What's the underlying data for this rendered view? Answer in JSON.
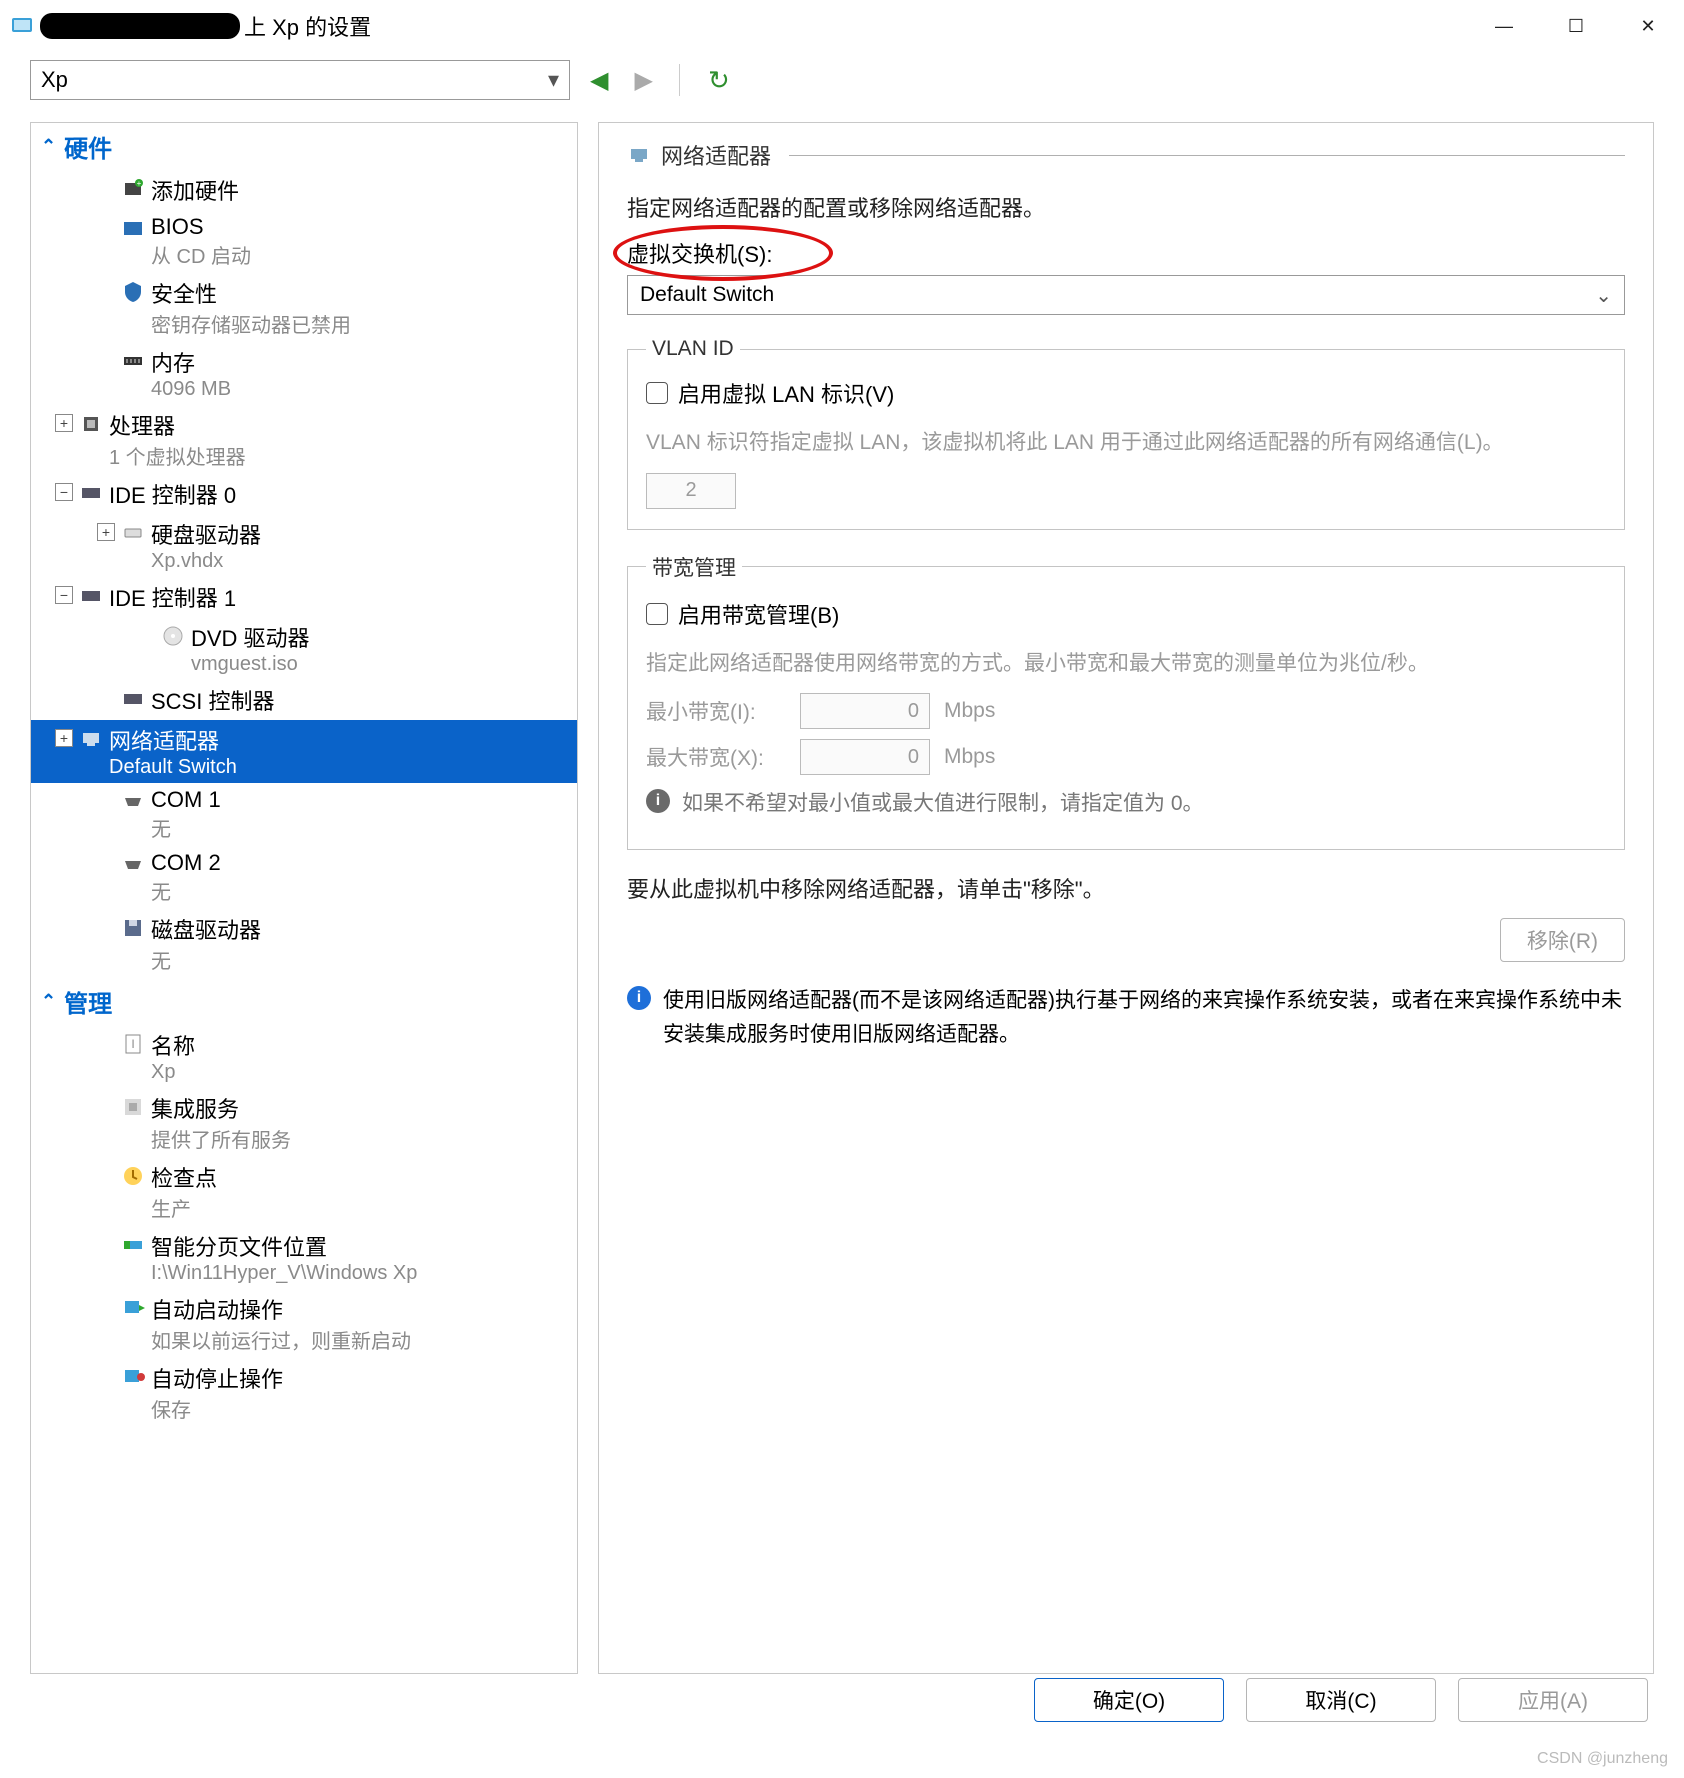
{
  "window": {
    "title_suffix": "上 Xp 的设置",
    "watermark": "CSDN @junzheng"
  },
  "toolbar": {
    "vm_selected": "Xp"
  },
  "tree": {
    "hardware_header": "硬件",
    "management_header": "管理",
    "items": {
      "add_hw": {
        "label": "添加硬件"
      },
      "bios": {
        "label": "BIOS",
        "sub": "从 CD 启动"
      },
      "security": {
        "label": "安全性",
        "sub": "密钥存储驱动器已禁用"
      },
      "memory": {
        "label": "内存",
        "sub": "4096 MB"
      },
      "cpu": {
        "label": "处理器",
        "sub": "1 个虚拟处理器"
      },
      "ide0": {
        "label": "IDE 控制器 0"
      },
      "hdd": {
        "label": "硬盘驱动器",
        "sub": "Xp.vhdx"
      },
      "ide1": {
        "label": "IDE 控制器 1"
      },
      "dvd": {
        "label": "DVD 驱动器",
        "sub": "vmguest.iso"
      },
      "scsi": {
        "label": "SCSI 控制器"
      },
      "nic": {
        "label": "网络适配器",
        "sub": "Default Switch"
      },
      "com1": {
        "label": "COM 1",
        "sub": "无"
      },
      "com2": {
        "label": "COM 2",
        "sub": "无"
      },
      "floppy": {
        "label": "磁盘驱动器",
        "sub": "无"
      },
      "name": {
        "label": "名称",
        "sub": "Xp"
      },
      "integ": {
        "label": "集成服务",
        "sub": "提供了所有服务"
      },
      "ckpt": {
        "label": "检查点",
        "sub": "生产"
      },
      "smart": {
        "label": "智能分页文件位置",
        "sub": "I:\\Win11Hyper_V\\Windows Xp"
      },
      "autostart": {
        "label": "自动启动操作",
        "sub": "如果以前运行过，则重新启动"
      },
      "autostop": {
        "label": "自动停止操作",
        "sub": "保存"
      }
    }
  },
  "right": {
    "title": "网络适配器",
    "instr": "指定网络适配器的配置或移除网络适配器。",
    "vswitch_label": "虚拟交换机(S):",
    "vswitch_value": "Default Switch",
    "vlan": {
      "legend": "VLAN ID",
      "enable_label": "启用虚拟 LAN 标识(V)",
      "desc": "VLAN 标识符指定虚拟 LAN，该虚拟机将此 LAN 用于通过此网络适配器的所有网络通信(L)。",
      "value": "2"
    },
    "bw": {
      "legend": "带宽管理",
      "enable_label": "启用带宽管理(B)",
      "desc": "指定此网络适配器使用网络带宽的方式。最小带宽和最大带宽的测量单位为兆位/秒。",
      "min_label": "最小带宽(I):",
      "max_label": "最大带宽(X):",
      "min_value": "0",
      "max_value": "0",
      "unit": "Mbps",
      "note": "如果不希望对最小值或最大值进行限制，请指定值为 0。"
    },
    "remove_instr": "要从此虚拟机中移除网络适配器，请单击\"移除\"。",
    "remove_btn": "移除(R)",
    "legacy_note": "使用旧版网络适配器(而不是该网络适配器)执行基于网络的来宾操作系统安装，或者在来宾操作系统中未安装集成服务时使用旧版网络适配器。"
  },
  "footer": {
    "ok": "确定(O)",
    "cancel": "取消(C)",
    "apply": "应用(A)"
  }
}
